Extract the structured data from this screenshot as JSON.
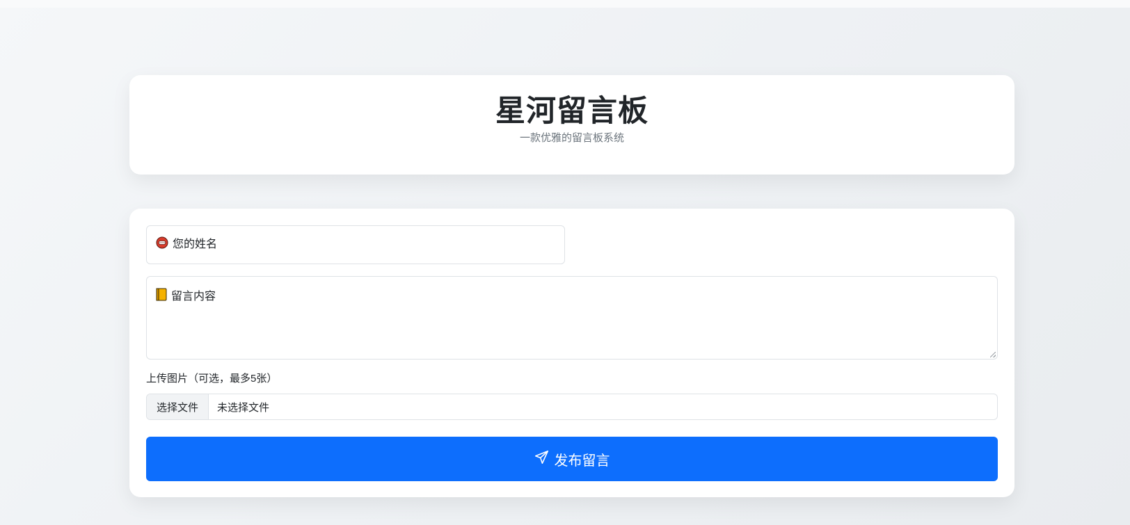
{
  "header": {
    "title": "星河留言板",
    "subtitle": "一款优雅的留言板系统"
  },
  "form": {
    "name_placeholder": "您的姓名",
    "name_icon": "face-emoji-icon",
    "content_placeholder": "留言内容",
    "content_icon": "notebook-emoji-icon",
    "upload_label": "上传图片（可选，最多5张）",
    "file_button_label": "选择文件",
    "file_status": "未选择文件",
    "submit_label": "发布留言",
    "submit_icon": "send-icon"
  },
  "colors": {
    "primary": "#0d6efd",
    "background": "#eef1f4",
    "card": "#ffffff"
  }
}
